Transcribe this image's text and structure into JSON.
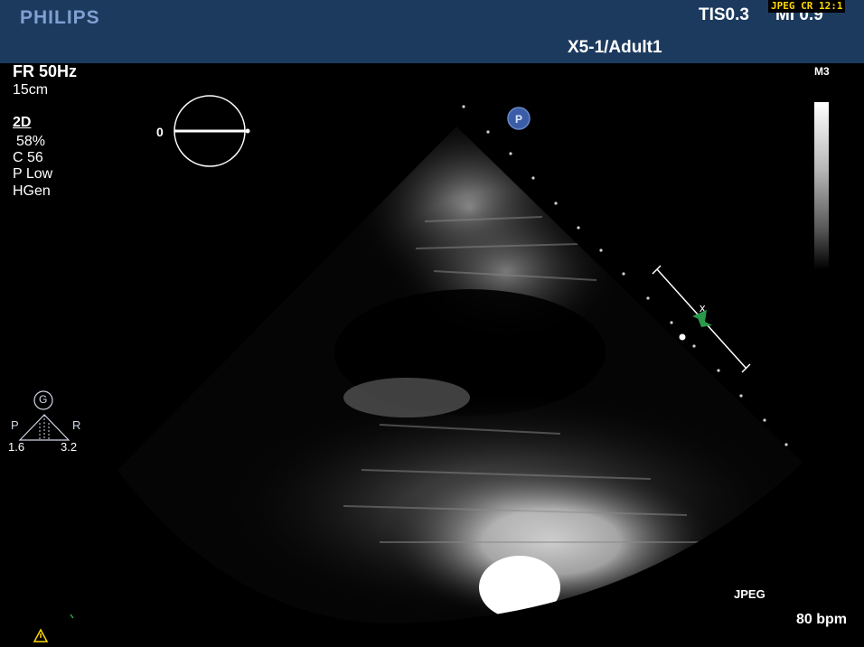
{
  "header": {
    "brand": "PHILIPS",
    "tis": "TIS0.3",
    "mi": "MI 0.9",
    "compression_badge": "JPEG CR 12:1",
    "probe_preset": "X5-1/Adult1"
  },
  "parameters": {
    "frame_rate": "FR 50Hz",
    "depth": "15cm",
    "mode": "2D",
    "gain": "58%",
    "compression": "C 56",
    "power": "P Low",
    "frequency": "HGen"
  },
  "map": {
    "label": "M3"
  },
  "orientation": {
    "angle": "0"
  },
  "xplane": {
    "gain_marker": "G",
    "left_label": "P",
    "right_label": "R",
    "left_value": "1.6",
    "right_value": "3.2"
  },
  "footer": {
    "format": "JPEG",
    "heart_rate": "80 bpm"
  },
  "colors": {
    "header_bg": "#1c3a5e",
    "brand": "#7fa0d2",
    "badge_text": "#ffd800",
    "probe_marker": "#3b5da8",
    "focus_marker": "#2a9a4a"
  },
  "icons": {
    "probe_marker": "P",
    "warning": "warning-icon"
  }
}
